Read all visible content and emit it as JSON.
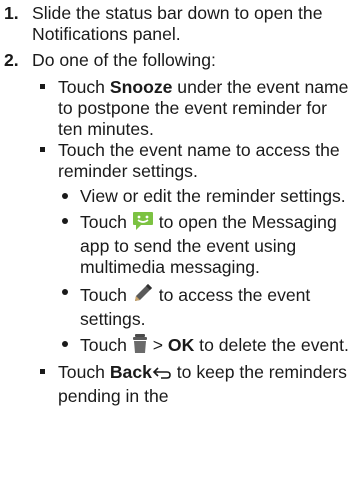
{
  "steps": [
    {
      "number": "1.",
      "text": "Slide the status bar down to open the Notifications panel."
    },
    {
      "number": "2.",
      "text": "Do one of the following:",
      "items": [
        {
          "prefix": "Touch ",
          "bold": "Snooze",
          "suffix": " under the event name to postpone the event reminder for ten minutes."
        },
        {
          "text": "Touch the event name to access the reminder settings.",
          "subitems": [
            {
              "text": "View or edit the reminder settings."
            },
            {
              "prefix": "Touch ",
              "icon": "message-icon",
              "suffix": " to open the Messaging app to send the event using multimedia messaging."
            },
            {
              "prefix": "Touch ",
              "icon": "pencil-icon",
              "suffix": " to access the event settings."
            },
            {
              "prefix": "Touch ",
              "icon": "trash-icon",
              "middle": " > ",
              "bold": "OK",
              "suffix": " to delete the event."
            }
          ]
        },
        {
          "prefix": "Touch ",
          "bold": "Back",
          "icon": "back-arrow-icon",
          "suffix": " to keep the reminders pending in the"
        }
      ]
    }
  ],
  "colors": {
    "text": "#1a1a1a",
    "message_icon": "#7cc242",
    "pencil_icon": "#4a4a4a",
    "trash_icon": "#5a5a5a"
  }
}
